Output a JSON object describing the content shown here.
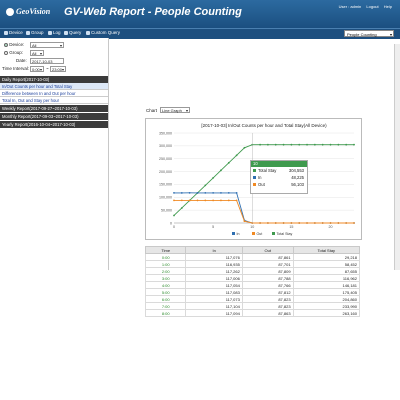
{
  "colors": {
    "total": "#3f9a4e",
    "in": "#2f6fb1",
    "out": "#f08a24",
    "header": "#1d4f7f"
  },
  "header": {
    "logo": "GeoVision",
    "title": "GV-Web Report - People Counting",
    "user_label": "User : admin",
    "logout_label": "Logout",
    "help_label": "Help"
  },
  "toolbar": {
    "items": [
      "Device",
      "Group",
      "Log",
      "Query",
      "Custom Query"
    ],
    "mode_value": "People Counting"
  },
  "filters": {
    "device_label": "Device:",
    "device_value": "All",
    "group_label": "Group:",
    "group_value": "All",
    "date_label": "Date:",
    "date_value": "2017-10-03",
    "interval_label": "Time Interval:",
    "interval_from": "0:00",
    "interval_to": "23:00"
  },
  "reports": {
    "daily_head": "Daily Report(2017-10-03)",
    "daily_items": [
      "In/Out Counts per hour and Total Stay",
      "Difference between In and Out per hour",
      "Total In, Out and Stay per hour"
    ],
    "weekly_head": "Weekly Report(2017-09-27~2017-10-03)",
    "monthly_head": "Monthly Report(2017-09-03~2017-10-03)",
    "yearly_head": "Yearly Report(2016-10-04~2017-10-03)"
  },
  "chart_control": {
    "label": "Chart",
    "value": "Line Graph"
  },
  "chart_data": {
    "type": "line",
    "title": "[2017-10-03] In/Out Counts per hour and Total Stay(All Device)",
    "x": [
      "0",
      "1",
      "2",
      "3",
      "4",
      "5",
      "6",
      "7",
      "8",
      "9",
      "10",
      "11",
      "12",
      "13",
      "14",
      "15",
      "16",
      "17",
      "18",
      "19",
      "20",
      "21",
      "22",
      "23"
    ],
    "ylim": [
      0,
      350000
    ],
    "yticks": [
      "0",
      "50,000",
      "100,000",
      "150,000",
      "200,000",
      "250,000",
      "300,000",
      "350,000"
    ],
    "xticks": [
      "0",
      "5",
      "10",
      "15",
      "20"
    ],
    "series": [
      {
        "name": "Total Stay",
        "values": [
          29218,
          58452,
          87655,
          116962,
          146181,
          175405,
          204860,
          233990,
          263220,
          292450,
          304553,
          304553,
          304553,
          304553,
          304553,
          304553,
          304553,
          304553,
          304553,
          304553,
          304553,
          304553,
          304553,
          304553
        ]
      },
      {
        "name": "In",
        "values": [
          117076,
          116935,
          117262,
          117006,
          117054,
          117083,
          117073,
          117104,
          117094,
          10000,
          0,
          0,
          0,
          0,
          0,
          0,
          0,
          0,
          0,
          0,
          0,
          0,
          0,
          0
        ]
      },
      {
        "name": "Out",
        "values": [
          87861,
          87861,
          87809,
          87788,
          87766,
          87798,
          87823,
          87823,
          87863,
          7000,
          0,
          0,
          0,
          0,
          0,
          0,
          0,
          0,
          0,
          0,
          0,
          0,
          0,
          0
        ]
      }
    ],
    "tooltip": {
      "header": "10",
      "rows": [
        {
          "name": "Total Stay",
          "value": "304,553"
        },
        {
          "name": "In",
          "value": "48,225"
        },
        {
          "name": "Out",
          "value": "56,103"
        }
      ]
    },
    "legend": [
      "In",
      "Out",
      "Total Stay"
    ],
    "legend_position": "bottom"
  },
  "table": {
    "headers": [
      "Time",
      "In",
      "Out",
      "Total Stay"
    ],
    "rows": [
      [
        "0:00",
        "117,076",
        "87,861",
        "29,218"
      ],
      [
        "1:00",
        "116,935",
        "87,701",
        "58,452"
      ],
      [
        "2:00",
        "117,262",
        "87,809",
        "87,655"
      ],
      [
        "3:00",
        "117,006",
        "87,788",
        "116,962"
      ],
      [
        "4:00",
        "117,054",
        "87,766",
        "146,181"
      ],
      [
        "5:00",
        "117,083",
        "87,812",
        "175,405"
      ],
      [
        "6:00",
        "117,073",
        "87,823",
        "204,860"
      ],
      [
        "7:00",
        "117,104",
        "87,823",
        "233,990"
      ],
      [
        "8:00",
        "117,094",
        "87,863",
        "263,160"
      ]
    ]
  }
}
